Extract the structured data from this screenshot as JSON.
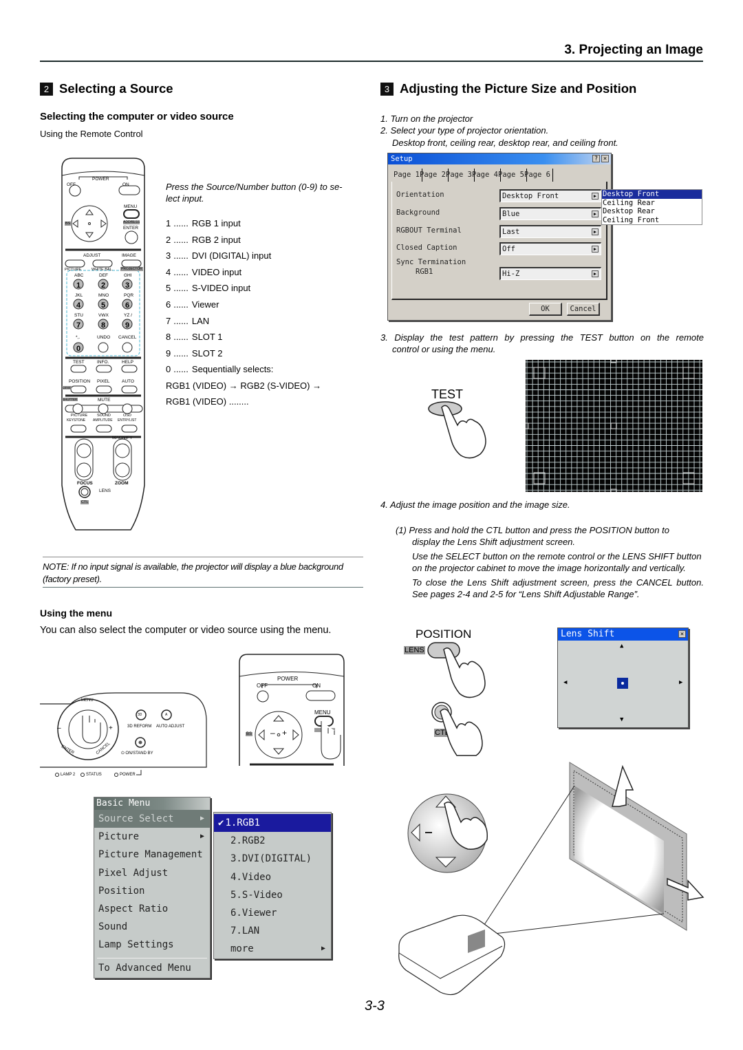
{
  "page": {
    "chapter_title": "3. Projecting an Image",
    "page_number": "3-3"
  },
  "left": {
    "section_number": "2",
    "section_title": "Selecting a Source",
    "subsection_title": "Selecting the computer or video source",
    "remote_caption": "Using the Remote Control",
    "instruction": "Press the Source/Number button (0-9) to se-lect input.",
    "instruction_line1": "Press the Source/Number button (0-9) to se-",
    "instruction_line2": "lect input.",
    "inputs": [
      {
        "key": "1",
        "label": "RGB 1 input"
      },
      {
        "key": "2",
        "label": "RGB 2 input"
      },
      {
        "key": "3",
        "label": "DVI (DIGITAL) input"
      },
      {
        "key": "4",
        "label": "VIDEO input"
      },
      {
        "key": "5",
        "label": "S-VIDEO input"
      },
      {
        "key": "6",
        "label": "Viewer"
      },
      {
        "key": "7",
        "label": "LAN"
      },
      {
        "key": "8",
        "label": "SLOT 1"
      },
      {
        "key": "9",
        "label": "SLOT 2"
      },
      {
        "key": "0",
        "label": "Sequentially selects:"
      }
    ],
    "leader": "......",
    "sequence_line1": "RGB1 (VIDEO) → RGB2 (S-VIDEO) →",
    "sequence_line2": "RGB1 (VIDEO) ........",
    "note": "NOTE: If no input signal is available, the projector will display a blue background (factory preset).",
    "menu_subsection_title": "Using the menu",
    "menu_text": "You can also select the computer or video source using the menu."
  },
  "remote": {
    "power": "POWER",
    "off": "OFF",
    "on": "ON",
    "menu": "MENU",
    "address": "ADDRESS",
    "enter": "ENTER",
    "bs": "BS",
    "adjust": "ADJUST",
    "image": "IMAGE",
    "picture": "PICTURE",
    "white_bal": "WHITE BAL.",
    "projector": "PROJECTOR",
    "keys": [
      {
        "letters": "ABC",
        "num": "1"
      },
      {
        "letters": "DEF",
        "num": "2"
      },
      {
        "letters": "GHI",
        "num": "3"
      },
      {
        "letters": "JKL",
        "num": "4"
      },
      {
        "letters": "MNO",
        "num": "5"
      },
      {
        "letters": "PQR",
        "num": "6"
      },
      {
        "letters": "STU",
        "num": "7"
      },
      {
        "letters": "VWX",
        "num": "8"
      },
      {
        "letters": "YZ /",
        "num": "9"
      },
      {
        "letters": "*,.",
        "num": "0"
      }
    ],
    "undo": "UNDO",
    "cancel": "CANCEL",
    "test": "TEST",
    "info": "INFO.",
    "help": "HELP",
    "position": "POSITION",
    "pixel": "PIXEL",
    "auto": "AUTO",
    "lens_tag": "LENS",
    "shutter": "SHUTTER",
    "mute": "MUTE",
    "picture2": "PICTURE",
    "sound": "SOUND",
    "osd": "OSD",
    "keystone": "KEYSTONE",
    "amplitude": "AMPLITUDE",
    "entrylist": "ENTRYLIST",
    "r": "R",
    "g": "G",
    "b": "B",
    "magnify": "MAGNIFY",
    "plus": "+",
    "minus": "–",
    "focus": "FOCUS",
    "zoom": "ZOOM",
    "lens": "LENS",
    "ctl": "CTL"
  },
  "cabinet": {
    "menu": "MENU",
    "enter": "ENTER",
    "cancel": "CANCEL",
    "select_minus": "–",
    "select_plus": "+",
    "btn_3d": "3D",
    "btn_a": "A",
    "reform": "3D REFORM",
    "auto_adjust": "AUTO ADJUST",
    "standby": "⏻ ON/STAND BY",
    "lamp2": "LAMP 2",
    "status": "STATUS",
    "power": "POWER"
  },
  "basic_menu": {
    "title": "Basic Menu",
    "items": [
      {
        "label": "Source Select",
        "submenu": true,
        "active": true
      },
      {
        "label": "Picture",
        "submenu": true
      },
      {
        "label": "Picture Management"
      },
      {
        "label": "Pixel Adjust"
      },
      {
        "label": "Position"
      },
      {
        "label": "Aspect Ratio"
      },
      {
        "label": "Sound"
      },
      {
        "label": "Lamp Settings"
      }
    ],
    "footer_item": "To Advanced Menu",
    "source_submenu": [
      {
        "label": "1.RGB1",
        "checked": true
      },
      {
        "label": "2.RGB2"
      },
      {
        "label": "3.DVI(DIGITAL)"
      },
      {
        "label": "4.Video"
      },
      {
        "label": "5.S-Video"
      },
      {
        "label": "6.Viewer"
      },
      {
        "label": "7.LAN"
      },
      {
        "label": "more",
        "submenu": true
      }
    ],
    "highlight_color": "#1a1a9e"
  },
  "right": {
    "section_number": "3",
    "section_title": "Adjusting the Picture Size and Position",
    "steps": [
      "1. Turn on the projector",
      "2. Select your type of projector orientation.",
      "Desktop front, ceiling rear, desktop rear, and ceiling front."
    ],
    "step3": "3. Display the test pattern by pressing the TEST button on the remote control or using the menu.",
    "step3_line1": "3. Display the test pattern by pressing the TEST button on the remote",
    "step3_line2": "control or using the menu.",
    "test_label": "TEST",
    "step4": "4. Adjust the image position and the image size.",
    "sub1_line1": "(1)  Press and hold the CTL button and press the POSITION button to",
    "sub1_line2": "display the Lens Shift adjustment screen.",
    "para2": "Use the SELECT button on the remote control or the LENS SHIFT button on the projector cabinet to move the image horizontally and vertically.",
    "para3": "To close the Lens Shift adjustment screen, press the CANCEL button. See pages 2-4 and 2-5 for “Lens Shift Adjustable Range”.",
    "position_label": "POSITION",
    "lens_tag": "LENS",
    "ctl_tag": "CTL"
  },
  "setup_dialog": {
    "title": "Setup",
    "help_btn": "?",
    "close_btn": "×",
    "tabs": [
      "Page 1",
      "Page 2",
      "Page 3",
      "Page 4",
      "Page 5",
      "Page 6"
    ],
    "active_tab": "Page 1",
    "fields": [
      {
        "label": "Orientation",
        "value": "Desktop Front"
      },
      {
        "label": "Background",
        "value": "Blue"
      },
      {
        "label": "RGBOUT Terminal",
        "value": "Last"
      },
      {
        "label": "Closed Caption",
        "value": "Off"
      },
      {
        "label": "Sync Termination",
        "sublabel": "RGB1",
        "value": "Hi-Z"
      }
    ],
    "orientation_options": [
      "Desktop Front",
      "Ceiling Rear",
      "Desktop Rear",
      "Ceiling Front"
    ],
    "selected_option": "Desktop Front",
    "ok": "OK",
    "cancel": "Cancel"
  },
  "lens_shift_dialog": {
    "title": "Lens Shift",
    "close_btn": "×"
  }
}
